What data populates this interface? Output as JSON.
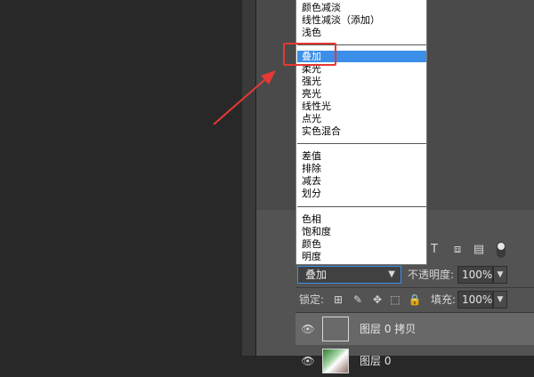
{
  "blend_menu": {
    "items": [
      "颜色减淡",
      "线性减淡（添加）",
      "浅色",
      "叠加",
      "柔光",
      "强光",
      "亮光",
      "线性光",
      "点光",
      "实色混合",
      "差值",
      "排除",
      "减去",
      "划分",
      "色相",
      "饱和度",
      "颜色",
      "明度"
    ],
    "selected": "叠加"
  },
  "layers_panel": {
    "blend_mode_value": "叠加",
    "opacity_label": "不透明度:",
    "opacity_value": "100%",
    "lock_label": "锁定:",
    "fill_label": "填充:",
    "fill_value": "100%",
    "layers": [
      {
        "name": "图层 0 拷贝",
        "selected": true,
        "visible": true
      },
      {
        "name": "图层 0",
        "selected": false,
        "visible": true
      }
    ]
  },
  "colors": {
    "highlight": "#3b8fe8",
    "annotation": "#e53935",
    "panel": "#535353",
    "canvas": "#282828"
  }
}
